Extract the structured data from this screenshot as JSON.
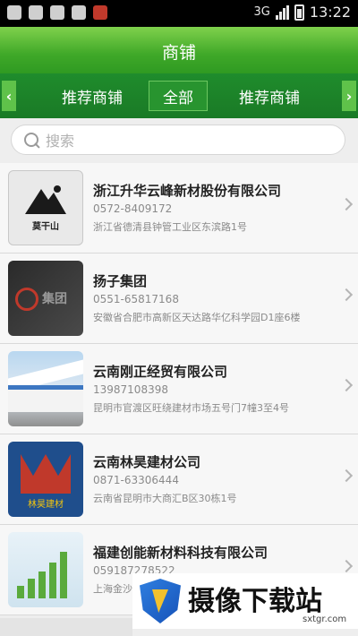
{
  "status_bar": {
    "network": "3G",
    "time": "13:22",
    "icons": [
      "app-icon",
      "gallery-icon",
      "mail-icon",
      "image-icon",
      "calendar-icon",
      "signal-icon",
      "battery-icon"
    ]
  },
  "header": {
    "title": "商铺"
  },
  "tabs": [
    {
      "label": "推荐商铺"
    },
    {
      "label": "全部",
      "selected": true
    },
    {
      "label": "推荐商铺"
    }
  ],
  "search": {
    "placeholder": "搜索",
    "value": ""
  },
  "shops": [
    {
      "name": "浙江升华云峰新材股份有限公司",
      "phone": "0572-8409172",
      "address": "浙江省德清县钟管工业区东滨路1号",
      "thumb_text": "莫干山"
    },
    {
      "name": "扬子集团",
      "phone": "0551-65817168",
      "address": "安徽省合肥市高新区天达路华亿科学园D1座6楼",
      "thumb_text": "集团"
    },
    {
      "name": "云南刚正经贸有限公司",
      "phone": "13987108398",
      "address": "昆明市官渡区旺绕建材市场五号门7幢3至4号",
      "thumb_text": ""
    },
    {
      "name": "云南林昊建材公司",
      "phone": "0871-63306444",
      "address": "云南省昆明市大商汇B区30栋1号",
      "thumb_text": "林昊建材"
    },
    {
      "name": "福建创能新材料科技有限公司",
      "phone": "059187278522",
      "address": "上海金沙",
      "thumb_text": ""
    }
  ],
  "watermark": {
    "title": "摄像下载站",
    "url": "sxtgr.com"
  },
  "colors": {
    "header_green": "#3fa828",
    "tab_green": "#1a7a26",
    "accent": "#5fc24a"
  }
}
